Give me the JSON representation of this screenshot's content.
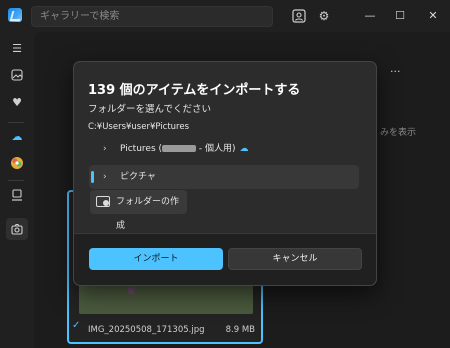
{
  "titlebar": {
    "search_placeholder": "ギャラリーで検索",
    "icons": [
      "face-scan-icon",
      "gear-icon"
    ],
    "window_controls": [
      "minimize",
      "maximize",
      "close"
    ]
  },
  "sidebar": {
    "items": [
      "hamburger-menu",
      "gallery",
      "favorites",
      "onedrive",
      "icloud-photos",
      "this-pc",
      "camera-import"
    ]
  },
  "background": {
    "visible_fragment_right": "みを表示",
    "more_glyph": "···",
    "photo_name": "IMG_20250508_171305.jpg",
    "photo_size": "8.9 MB"
  },
  "dialog": {
    "title": "139 個のアイテムをインポートする",
    "subtitle": "フォルダーを選んでください",
    "path": "C:¥Users¥user¥Pictures",
    "tree": [
      {
        "label_prefix": "Pictures (",
        "label_suffix": " - 個人用)",
        "has_cloud": true,
        "selected": false
      },
      {
        "label": "ピクチャ",
        "selected": true
      }
    ],
    "new_folder_label": "フォルダーの作成",
    "import_label": "インポート",
    "cancel_label": "キャンセル"
  },
  "colors": {
    "accent": "#4cc2ff",
    "dialog_bg": "#2c2c2c",
    "window_bg": "#202020"
  }
}
